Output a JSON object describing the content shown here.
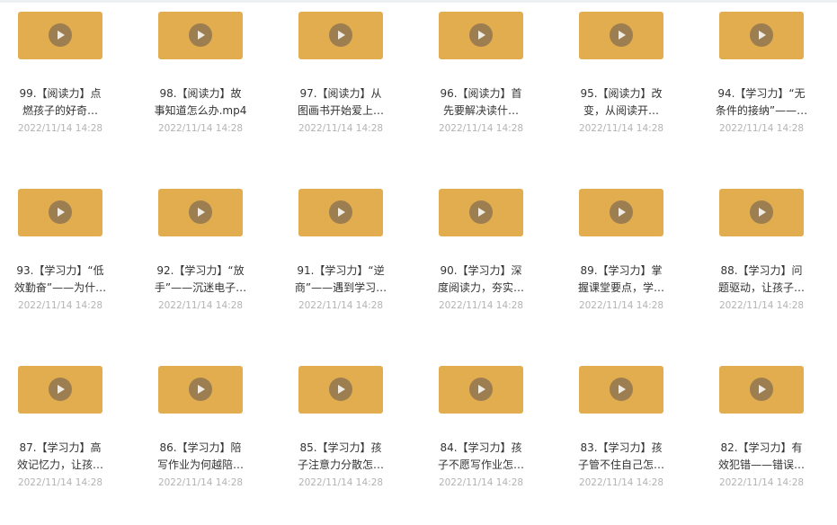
{
  "files": [
    {
      "name": "99.【阅读力】点\n燃孩子的好奇…",
      "date": "2022/11/14 14:28"
    },
    {
      "name": "98.【阅读力】故\n事知道怎么办.mp4",
      "date": "2022/11/14 14:28"
    },
    {
      "name": "97.【阅读力】从\n图画书开始爱上…",
      "date": "2022/11/14 14:28"
    },
    {
      "name": "96.【阅读力】首\n先要解决读什…",
      "date": "2022/11/14 14:28"
    },
    {
      "name": "95.【阅读力】改\n变，从阅读开…",
      "date": "2022/11/14 14:28"
    },
    {
      "name": "94.【学习力】“无\n条件的接纳”——…",
      "date": "2022/11/14 14:28"
    },
    {
      "name": "93.【学习力】“低\n效勤奋”——为什…",
      "date": "2022/11/14 14:28"
    },
    {
      "name": "92.【学习力】“放\n手”——沉迷电子…",
      "date": "2022/11/14 14:28"
    },
    {
      "name": "91.【学习力】“逆\n商”——遇到学习…",
      "date": "2022/11/14 14:28"
    },
    {
      "name": "90.【学习力】深\n度阅读力，夯实…",
      "date": "2022/11/14 14:28"
    },
    {
      "name": "89.【学习力】掌\n握课堂要点，学…",
      "date": "2022/11/14 14:28"
    },
    {
      "name": "88.【学习力】问\n题驱动，让孩子…",
      "date": "2022/11/14 14:28"
    },
    {
      "name": "87.【学习力】高\n效记忆力，让孩…",
      "date": "2022/11/14 14:28"
    },
    {
      "name": "86.【学习力】陪\n写作业为何越陪…",
      "date": "2022/11/14 14:28"
    },
    {
      "name": "85.【学习力】孩\n子注意力分散怎…",
      "date": "2022/11/14 14:28"
    },
    {
      "name": "84.【学习力】孩\n子不愿写作业怎…",
      "date": "2022/11/14 14:28"
    },
    {
      "name": "83.【学习力】孩\n子管不住自己怎…",
      "date": "2022/11/14 14:28"
    },
    {
      "name": "82.【学习力】有\n效犯错——错误…",
      "date": "2022/11/14 14:28"
    }
  ]
}
